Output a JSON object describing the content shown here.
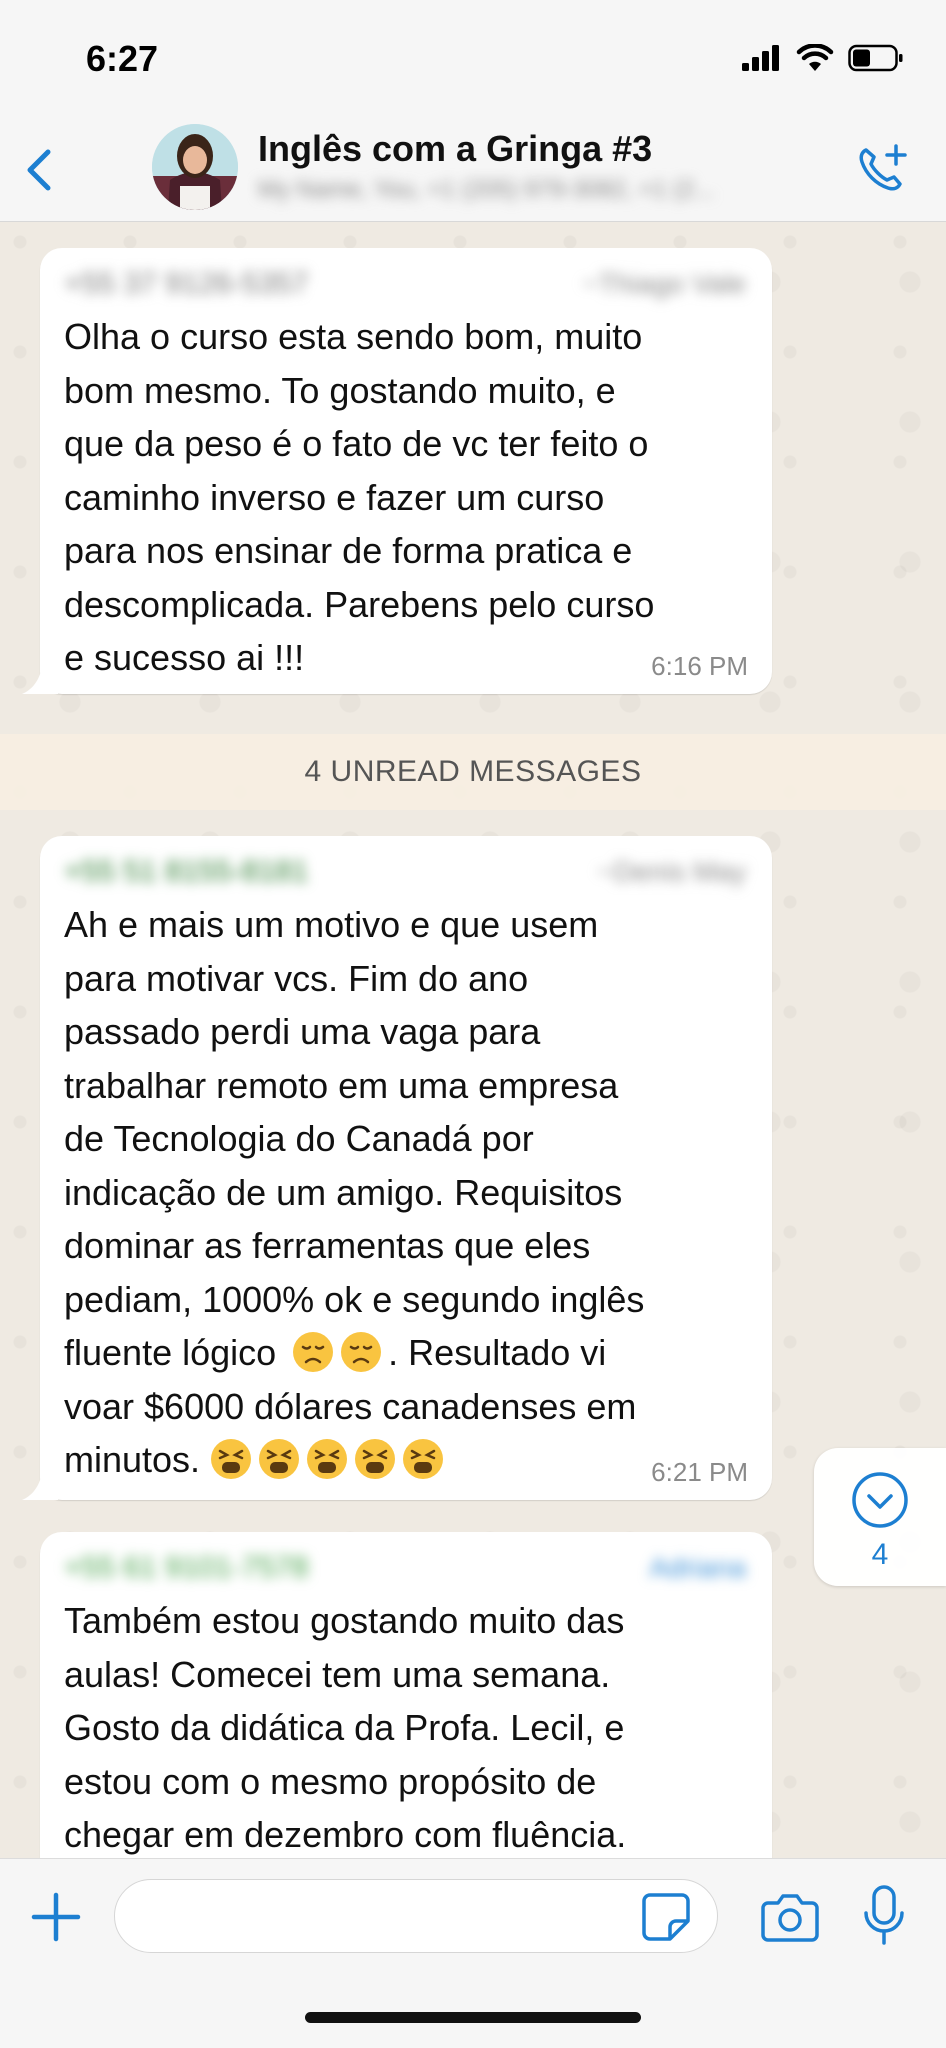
{
  "status_bar": {
    "time": "6:27"
  },
  "header": {
    "title": "Inglês com a Gringa #3",
    "subtitle": "My Name, You, +1 (205) 979-3082, +1 (2..."
  },
  "messages": [
    {
      "sender_phone": "+55 37 9126-5357",
      "sender_name": "~Thiago Vale",
      "text": "Olha o curso esta sendo bom, muito\nbom mesmo. To gostando muito, e\nque da peso é o fato de vc ter feito o\ncaminho inverso e fazer um curso\npara nos ensinar de forma pratica e\ndescomplicada. Parebens pelo curso\ne sucesso ai !!!",
      "time": "6:16 PM"
    },
    {
      "sender_phone": "+55 51 8155-8181",
      "sender_name": "~Denis May",
      "text_lines": [
        "Ah e mais um motivo e que usem",
        "para motivar vcs. Fim do ano",
        "passado perdi uma vaga para",
        "trabalhar remoto em uma empresa",
        "de Tecnologia do Canadá por",
        "indicação de um amigo. Requisitos",
        "dominar as ferramentas que eles",
        "pediam, 1000% ok e segundo inglês"
      ],
      "line9_start": "fluente lógico",
      "line9_end": ". Resultado vi",
      "line10": "voar $6000 dólares canadenses em",
      "line11": "minutos.",
      "time": "6:21 PM"
    },
    {
      "sender_phone": "+55 61 9101-7578",
      "sender_name": "Adriana",
      "text": "Também estou gostando muito das\naulas! Comecei tem uma semana.\nGosto da didática da Profa. Lecil, e\nestou com o mesmo propósito de\nchegar  em dezembro com fluência."
    }
  ],
  "unread_banner": "4 UNREAD MESSAGES",
  "scroll_down": {
    "count": "4"
  },
  "input": {
    "value": "",
    "placeholder": ""
  },
  "colors": {
    "accent": "#1d7fd1",
    "bubble": "#ffffff",
    "chat_bg": "#efeae2"
  }
}
